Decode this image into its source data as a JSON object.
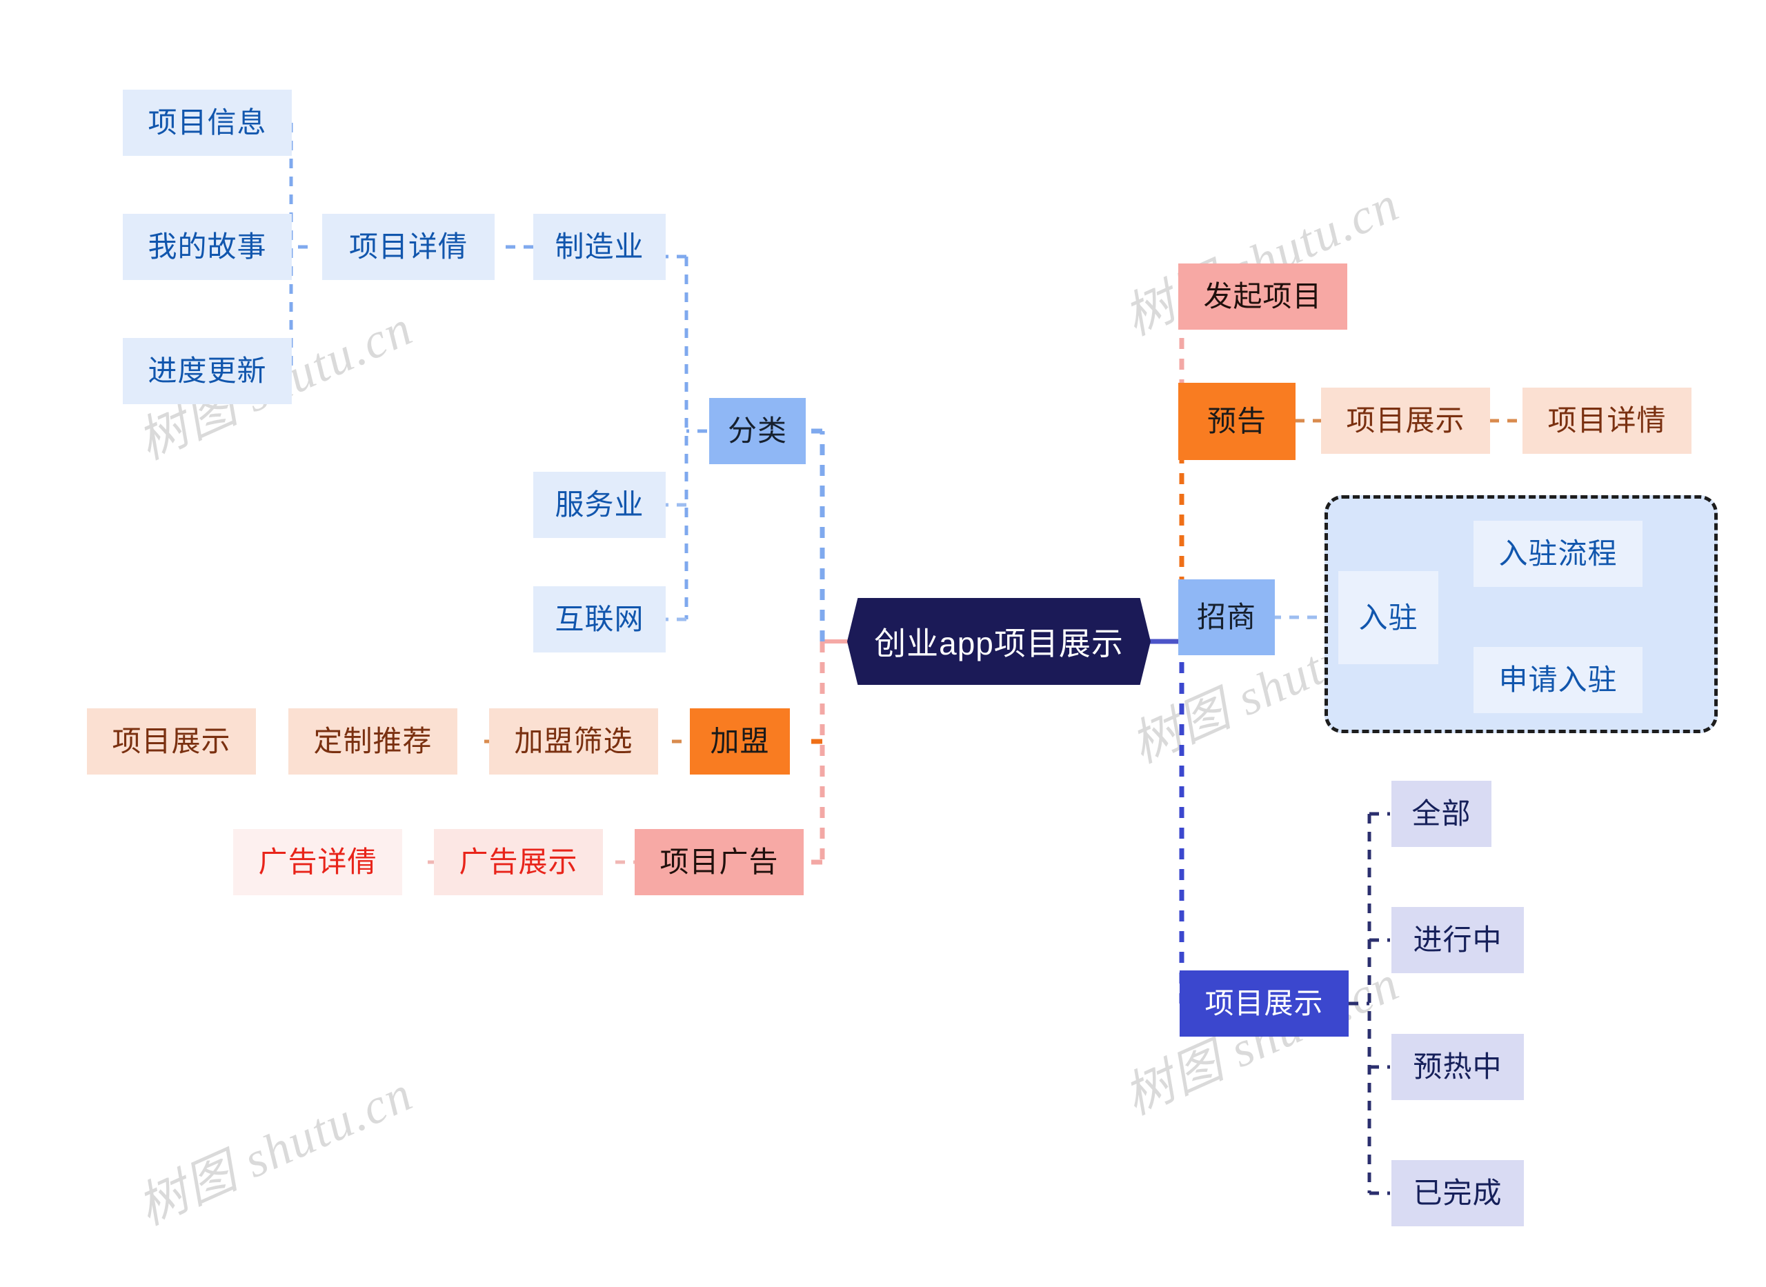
{
  "diagram": {
    "title": "创业app项目展示",
    "type": "mindmap",
    "watermark": "树图 shutu.cn",
    "root": {
      "label": "创业app项目展示",
      "color": "#1b1a57",
      "text_color": "#ffffff"
    }
  },
  "palette": {
    "light_blue": "#e2ecfb",
    "pale_blue": "#eaf1fd",
    "mid_blue": "#8fb7f5",
    "deep_blue": "#3b47ce",
    "lavender": "#d9dbf3",
    "peach": "#fbe0d2",
    "orange": "#f97c21",
    "salmon": "#f7a8a4",
    "pink": "#fbd9d6",
    "pale_pink": "#fdf0ef",
    "blue_text": "#1156ad",
    "brown_text": "#7a3010",
    "red_text": "#e8241a",
    "navy_text": "#16205a"
  },
  "branches": {
    "classification": {
      "label": "分类",
      "children": [
        {
          "label": "制造业",
          "children": [
            {
              "label": "项目详倩",
              "children": [
                {
                  "label": "项目信息"
                },
                {
                  "label": "我的故事"
                },
                {
                  "label": "进度更新"
                }
              ]
            }
          ]
        },
        {
          "label": "服务业"
        },
        {
          "label": "互联网"
        }
      ]
    },
    "franchise": {
      "label": "加盟",
      "children": [
        {
          "label": "加盟筛选",
          "children": [
            {
              "label": "定制推荐",
              "children": [
                {
                  "label": "项目展示"
                }
              ]
            }
          ]
        }
      ]
    },
    "project_ad": {
      "label": "项目广告",
      "children": [
        {
          "label": "广告展示",
          "children": [
            {
              "label": "广告详倩"
            }
          ]
        }
      ]
    },
    "start_project": {
      "label": "发起项目"
    },
    "preview": {
      "label": "预告",
      "children": [
        {
          "label": "项目展示",
          "children": [
            {
              "label": "项目详情"
            }
          ]
        }
      ]
    },
    "investment": {
      "label": "招商",
      "children": [
        {
          "label": "入驻",
          "children": [
            {
              "label": "入驻流程"
            },
            {
              "label": "申请入驻"
            }
          ]
        }
      ]
    },
    "project_display": {
      "label": "项目展示",
      "children": [
        {
          "label": "全部"
        },
        {
          "label": "进行中"
        },
        {
          "label": "预热中"
        },
        {
          "label": "已完成"
        }
      ]
    }
  },
  "nodes": {
    "project_info": "项目信息",
    "my_story": "我的故事",
    "progress_update": "进度更新",
    "project_detail_left": "项目详倩",
    "manufacturing": "制造业",
    "service": "服务业",
    "internet": "互联网",
    "classification": "分类",
    "project_show_left": "项目展示",
    "custom_recommend": "定制推荐",
    "franchise_filter": "加盟筛选",
    "franchise": "加盟",
    "ad_detail": "广告详倩",
    "ad_show": "广告展示",
    "project_ad": "项目广告",
    "root": "创业app项目展示",
    "start_project": "发起项目",
    "preview": "预告",
    "project_show_preview": "项目展示",
    "project_detail_right": "项目详情",
    "investment": "招商",
    "settle_in": "入驻",
    "settle_process": "入驻流程",
    "apply_settle": "申请入驻",
    "project_display": "项目展示",
    "all": "全部",
    "ongoing": "进行中",
    "warming_up": "预热中",
    "completed": "已完成"
  }
}
